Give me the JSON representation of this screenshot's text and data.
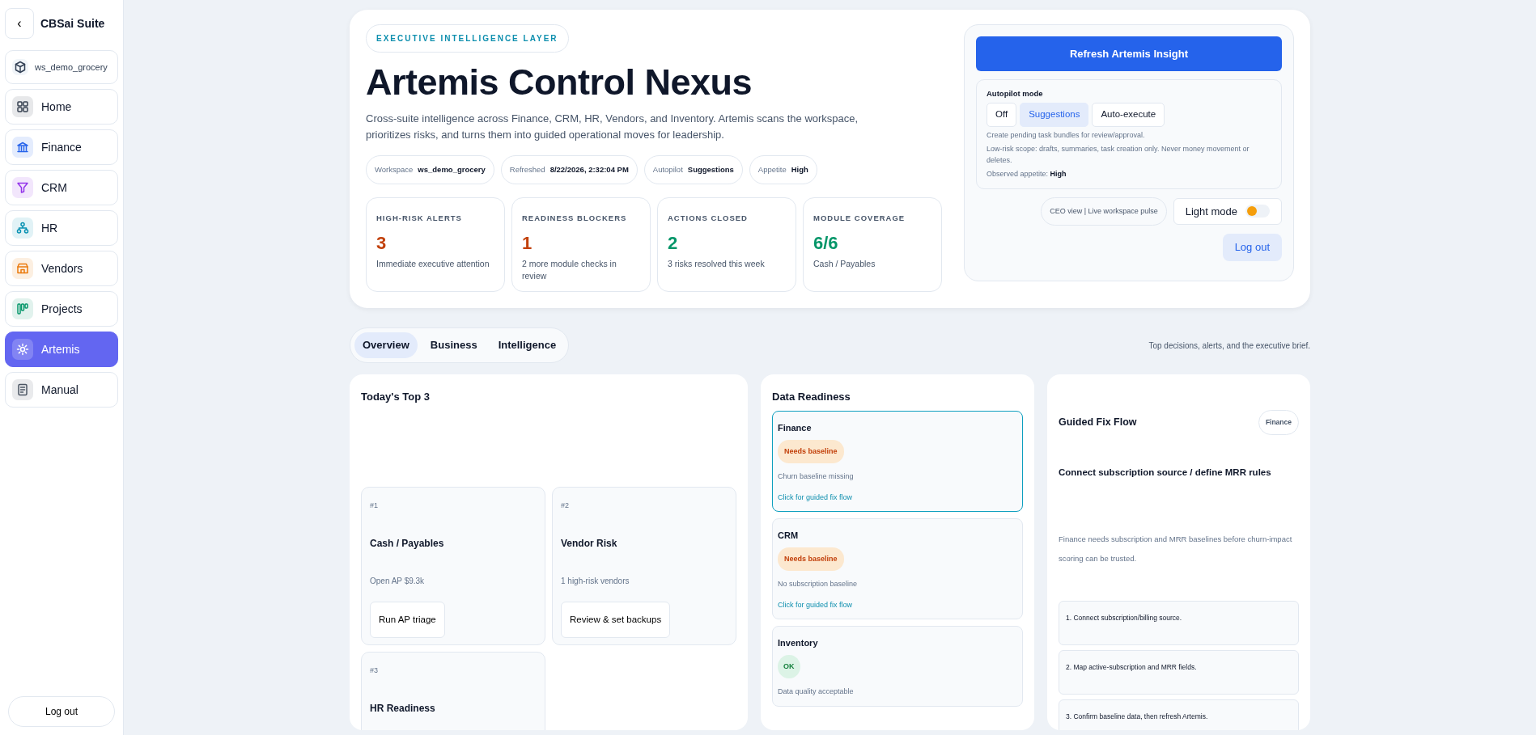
{
  "sidebar": {
    "back": "‹",
    "brand": "CBSai Suite",
    "workspace": "ws_demo_grocery",
    "items": [
      {
        "label": "Home",
        "kind": "home",
        "selected": false
      },
      {
        "label": "Finance",
        "kind": "bank",
        "selected": false
      },
      {
        "label": "CRM",
        "kind": "funnel",
        "selected": false
      },
      {
        "label": "HR",
        "kind": "network",
        "selected": false
      },
      {
        "label": "Vendors",
        "kind": "store",
        "selected": false
      },
      {
        "label": "Projects",
        "kind": "board",
        "selected": false
      },
      {
        "label": "Artemis",
        "kind": "sun",
        "selected": true
      },
      {
        "label": "Manual",
        "kind": "book",
        "selected": false
      }
    ],
    "logout": "Log out"
  },
  "header": {
    "eyebrow": "EXECUTIVE INTELLIGENCE LAYER",
    "title": "Artemis Control Nexus",
    "description": "Cross-suite intelligence across Finance, CRM, HR, Vendors, and Inventory. Artemis scans the workspace, prioritizes risks, and turns them into guided operational moves for leadership.",
    "chips": [
      {
        "label": "Workspace",
        "value": "ws_demo_grocery"
      },
      {
        "label": "Refreshed",
        "value": "8/22/2026, 2:32:04 PM"
      },
      {
        "label": "Autopilot",
        "value": "Suggestions"
      },
      {
        "label": "Appetite",
        "value": "High"
      }
    ],
    "metrics": [
      {
        "label": "HIGH-RISK ALERTS",
        "value": "3",
        "note": "Immediate executive attention",
        "color": "#c2410c"
      },
      {
        "label": "READINESS BLOCKERS",
        "value": "1",
        "note": "2 more module checks in review",
        "color": "#c2410c"
      },
      {
        "label": "ACTIONS CLOSED",
        "value": "2",
        "note": "3 risks resolved this week",
        "color": "#059669"
      },
      {
        "label": "MODULE COVERAGE",
        "value": "6/6",
        "note": "Cash / Payables",
        "color": "#059669"
      }
    ]
  },
  "control": {
    "refresh": "Refresh Artemis Insight",
    "autopilot": {
      "title": "Autopilot mode",
      "options": [
        {
          "label": "Off",
          "selected": false
        },
        {
          "label": "Suggestions",
          "selected": true
        },
        {
          "label": "Auto-execute",
          "selected": false
        }
      ],
      "description": "Create pending task bundles for review/approval.",
      "scope": "Low-risk scope: drafts, summaries, task creation only. Never money movement or deletes.",
      "appetite": "Observed appetite: **High**"
    },
    "view_badge": "CEO view | Live workspace pulse",
    "theme_toggle": {
      "label": "Light mode",
      "on": false
    },
    "logout": "Log out"
  },
  "tabs": [
    {
      "label": "Overview",
      "selected": true
    },
    {
      "label": "Business",
      "selected": false
    },
    {
      "label": "Intelligence",
      "selected": false
    }
  ],
  "tab_hint": "Top decisions, alerts, and the executive brief.",
  "top3": {
    "title": "Today's Top 3",
    "items": [
      {
        "rank": "#1",
        "title": "Cash / Payables",
        "detail": "Open AP $9.3k",
        "action": "Run AP triage"
      },
      {
        "rank": "#2",
        "title": "Vendor Risk",
        "detail": "1 high-risk vendors",
        "action": "Review & set backups"
      },
      {
        "rank": "#3",
        "title": "HR Readiness"
      }
    ]
  },
  "readiness": {
    "title": "Data Readiness",
    "items": [
      {
        "name": "Finance",
        "status": "Needs baseline",
        "kind": "warn",
        "detail": "Churn baseline missing",
        "link": "Click for guided fix flow",
        "selected": true
      },
      {
        "name": "CRM",
        "status": "Needs baseline",
        "kind": "warn",
        "detail": "No subscription baseline",
        "link": "Click for guided fix flow",
        "selected": false
      },
      {
        "name": "Inventory",
        "status": "OK",
        "kind": "ok",
        "detail": "Data quality acceptable",
        "selected": false
      }
    ]
  },
  "fix_flow": {
    "title": "Guided Fix Flow",
    "tag": "Finance",
    "heading": "Connect subscription source / define MRR rules",
    "description": "Finance needs subscription and MRR baselines before churn-impact scoring can be trusted.",
    "steps": [
      "1. Connect subscription/billing source.",
      "2. Map active-subscription and MRR fields.",
      "3. Confirm baseline data, then refresh Artemis."
    ]
  }
}
